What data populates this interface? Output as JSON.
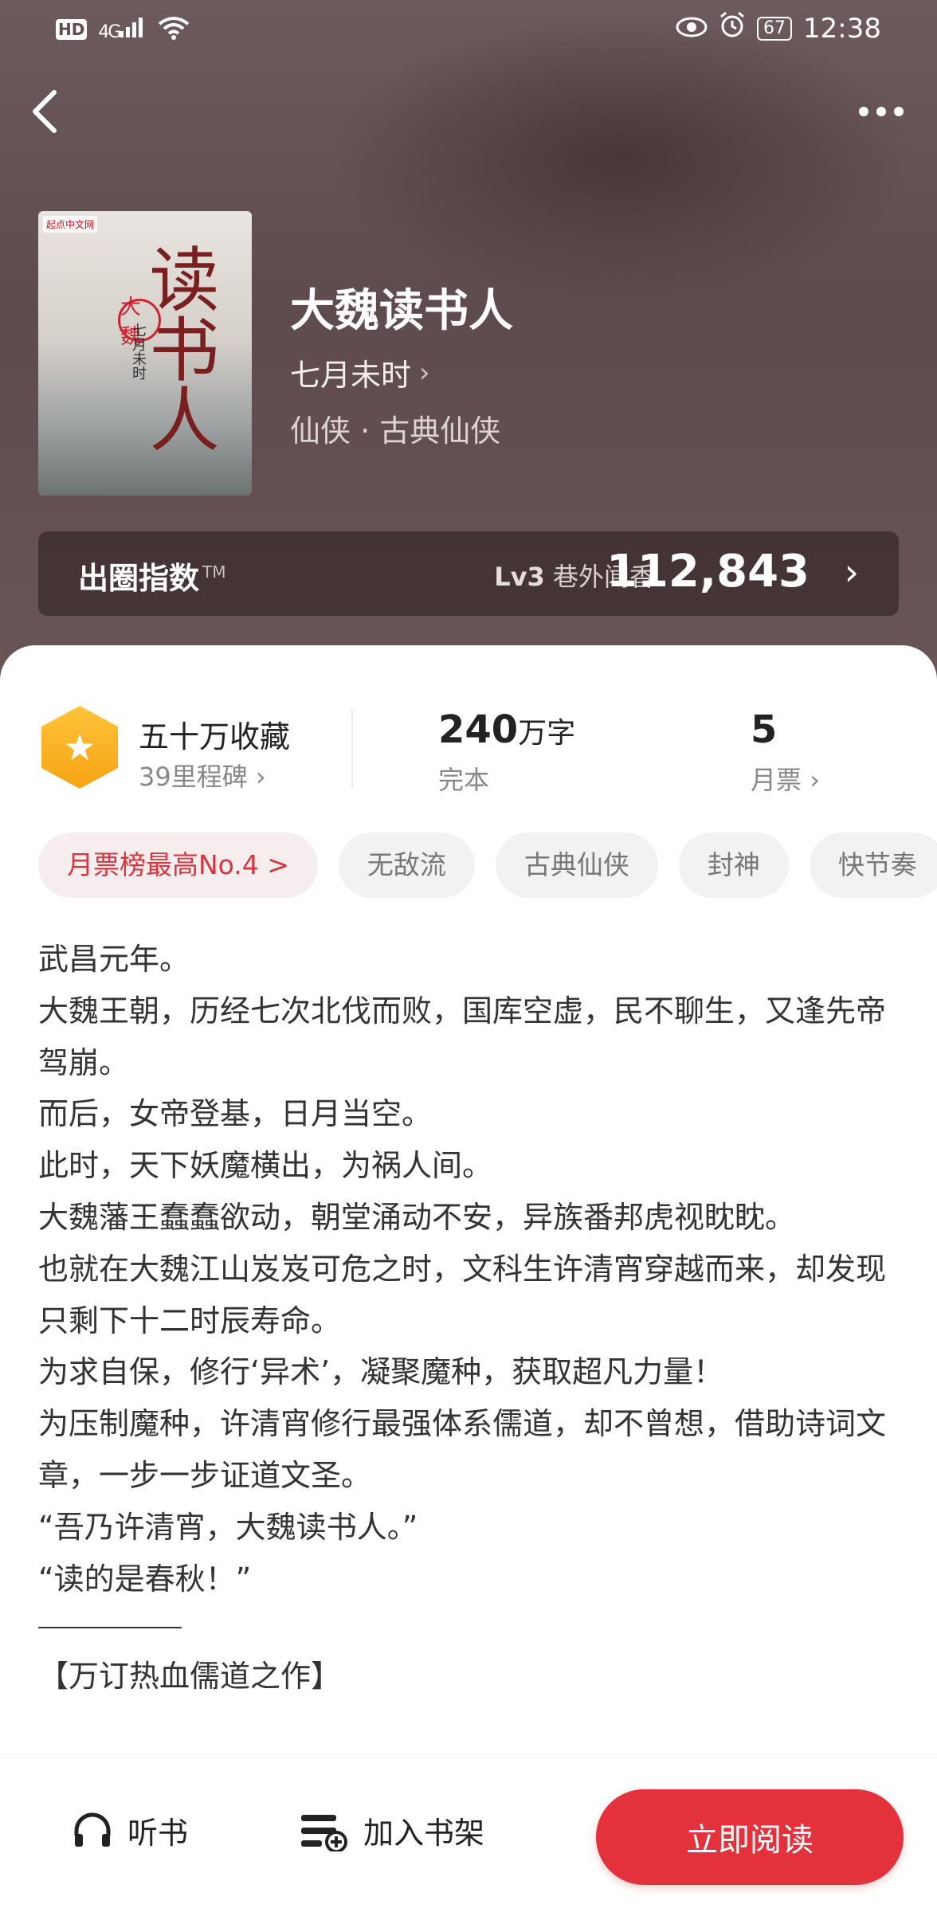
{
  "status_bar": {
    "hd": "HD",
    "network": "4G",
    "battery": "67",
    "time": "12:38"
  },
  "cover": {
    "badge": "起点中文网",
    "title": "读书人",
    "seal": "大魏",
    "author": "七月未时"
  },
  "book": {
    "title": "大魏读书人",
    "author": "七月未时",
    "genre": "仙侠 · 古典仙侠"
  },
  "index": {
    "label": "出圈指数",
    "tm": "TM",
    "level_prefix": "Lv3",
    "level_name": "巷外闻香",
    "score": "112,843"
  },
  "stats": {
    "collect_main": "五十万收藏",
    "collect_sub": "39里程碑",
    "words_number": "240",
    "words_unit": "万字",
    "words_sub": "完本",
    "ticket_main": "5",
    "ticket_sub": "月票"
  },
  "tags": [
    "月票榜最高No.4 >",
    "无敌流",
    "古典仙侠",
    "封神",
    "快节奏"
  ],
  "intro": [
    "武昌元年。",
    "大魏王朝，历经七次北伐而败，国库空虚，民不聊生，又逢先帝驾崩。",
    "而后，女帝登基，日月当空。",
    "此时，天下妖魔横出，为祸人间。",
    "大魏藩王蠢蠢欲动，朝堂涌动不安，异族番邦虎视眈眈。",
    "也就在大魏江山岌岌可危之时，文科生许清宵穿越而来，却发现只剩下十二时辰寿命。",
    "为求自保，修行‘异术’，凝聚魔种，获取超凡力量！",
    "为压制魔种，许清宵修行最强体系儒道，却不曾想，借助诗词文章，一步一步证道文圣。",
    "“吾乃许清宵，大魏读书人。”",
    "“读的是春秋！”"
  ],
  "intro_tail": "【万订热血儒道之作】",
  "bottom": {
    "listen": "听书",
    "shelf": "加入书架",
    "read": "立即阅读"
  },
  "colors": {
    "accent_red": "#e4323c",
    "badge_gold": "#f5a313",
    "hero_bg": "#5e4b4d"
  }
}
